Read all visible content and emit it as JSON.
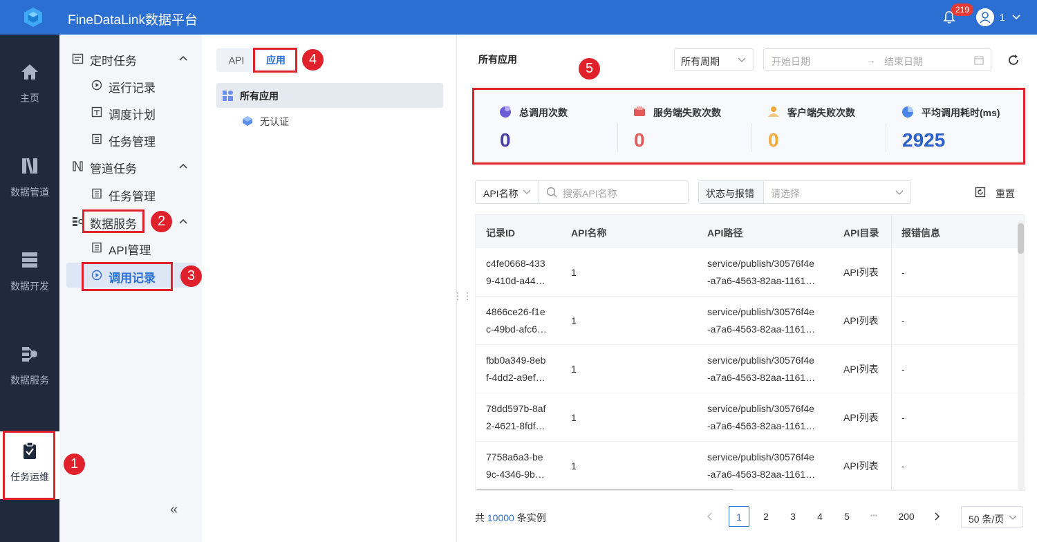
{
  "header": {
    "app_title": "FineDataLink数据平台",
    "notification_count": "219",
    "user_name": "1",
    "icons": [
      "logo-cube-icon",
      "bell-icon",
      "user-avatar-icon",
      "chevron-down-icon"
    ]
  },
  "rail": {
    "items": [
      {
        "label": "主页",
        "icon": "home-icon"
      },
      {
        "label": "数据管道",
        "icon": "pipeline-icon"
      },
      {
        "label": "数据开发",
        "icon": "database-icon"
      },
      {
        "label": "数据服务",
        "icon": "data-service-icon"
      },
      {
        "label": "任务运维",
        "icon": "clipboard-check-icon",
        "active": true
      }
    ]
  },
  "sidebar": {
    "groups": [
      {
        "label": "定时任务",
        "icon": "calendar-icon",
        "children": [
          {
            "label": "运行记录",
            "icon": "play-circle-icon"
          },
          {
            "label": "调度计划",
            "icon": "schedule-icon"
          },
          {
            "label": "任务管理",
            "icon": "task-list-icon"
          }
        ]
      },
      {
        "label": "管道任务",
        "icon": "pipeline-icon",
        "children": [
          {
            "label": "任务管理",
            "icon": "task-list-icon"
          }
        ]
      },
      {
        "label": "数据服务",
        "icon": "data-service-icon",
        "children": [
          {
            "label": "API管理",
            "icon": "task-list-icon"
          },
          {
            "label": "调用记录",
            "icon": "play-circle-icon",
            "active": true
          }
        ]
      }
    ],
    "collapse_label": "«"
  },
  "middle": {
    "tabs": [
      {
        "label": "API"
      },
      {
        "label": "应用",
        "active": true
      }
    ],
    "tree_all_label": "所有应用",
    "tree_child_label": "无认证"
  },
  "main": {
    "title": "所有应用",
    "period_value": "所有周期",
    "start_date_placeholder": "开始日期",
    "date_arrow": "→",
    "end_date_placeholder": "结束日期",
    "stats": [
      {
        "label": "总调用次数",
        "value": "0",
        "color": "#4a3fa8",
        "icon": "call-count-icon"
      },
      {
        "label": "服务端失败次数",
        "value": "0",
        "color": "#e25a5a",
        "icon": "server-fail-icon"
      },
      {
        "label": "客户端失败次数",
        "value": "0",
        "color": "#f0a93a",
        "icon": "client-fail-icon"
      },
      {
        "label": "平均调用耗时(ms)",
        "value": "2925",
        "color": "#2a5fc9",
        "icon": "avg-time-icon"
      }
    ],
    "filter_field": "API名称",
    "search_placeholder": "搜索API名称",
    "status_label": "状态与报错",
    "status_placeholder": "请选择",
    "reset_label": "重置",
    "table": {
      "columns": [
        "记录ID",
        "API名称",
        "API路径",
        "API目录",
        "报错信息"
      ],
      "rows": [
        {
          "id1": "c4fe0668-433",
          "id2": "9-410d-a44…",
          "name": "1",
          "path1": "service/publish/30576f4e",
          "path2": "-a7a6-4563-82aa-1161…",
          "dir": "API列表",
          "err": "-"
        },
        {
          "id1": "4866ce26-f1e",
          "id2": "c-49bd-afc6…",
          "name": "1",
          "path1": "service/publish/30576f4e",
          "path2": "-a7a6-4563-82aa-1161…",
          "dir": "API列表",
          "err": "-"
        },
        {
          "id1": "fbb0a349-8eb",
          "id2": "f-4dd2-a9ef…",
          "name": "1",
          "path1": "service/publish/30576f4e",
          "path2": "-a7a6-4563-82aa-1161…",
          "dir": "API列表",
          "err": "-"
        },
        {
          "id1": "78dd597b-8af",
          "id2": "2-4621-8fdf…",
          "name": "1",
          "path1": "service/publish/30576f4e",
          "path2": "-a7a6-4563-82aa-1161…",
          "dir": "API列表",
          "err": "-"
        },
        {
          "id1": "7758a6a3-be",
          "id2": "9c-4346-9b…",
          "name": "1",
          "path1": "service/publish/30576f4e",
          "path2": "-a7a6-4563-82aa-1161…",
          "dir": "API列表",
          "err": "-"
        }
      ]
    },
    "pagination": {
      "total_prefix": "共",
      "total_count": "10000",
      "total_suffix": "条实例",
      "pages": [
        "1",
        "2",
        "3",
        "4",
        "5",
        "•••",
        "200"
      ],
      "current_page": "1",
      "page_size": "50 条/页"
    }
  },
  "annotations": [
    "1",
    "2",
    "3",
    "4",
    "5"
  ],
  "colors": {
    "brand": "#2a6fd1",
    "rail_bg": "#1f2a3c",
    "highlight": "#e0202a"
  }
}
